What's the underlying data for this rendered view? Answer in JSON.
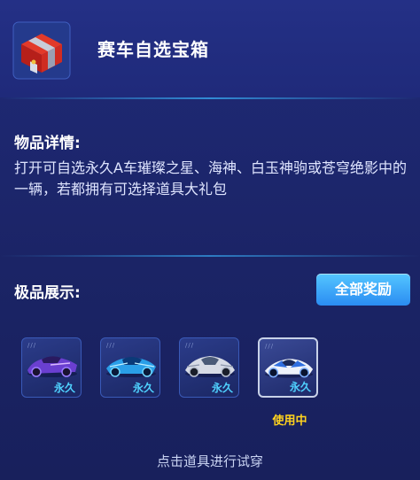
{
  "header": {
    "title": "赛车自选宝箱",
    "icon": "treasure-chest-icon"
  },
  "details": {
    "label": "物品详情:",
    "description": "打开可自选永久A车璀璨之星、海神、白玉神驹或苍穹绝影中的一辆，若都拥有可选择道具大礼包"
  },
  "showcase": {
    "label": "极品展示:",
    "all_rewards_button": "全部奖励",
    "items": [
      {
        "tag": "永久",
        "icon": "purple-race-car-icon"
      },
      {
        "tag": "永久",
        "icon": "blue-race-car-icon"
      },
      {
        "tag": "永久",
        "icon": "silver-race-car-icon"
      },
      {
        "tag": "永久",
        "icon": "white-blue-race-car-icon",
        "status": "使用中"
      }
    ]
  },
  "footer": {
    "hint": "点击道具进行试穿"
  }
}
